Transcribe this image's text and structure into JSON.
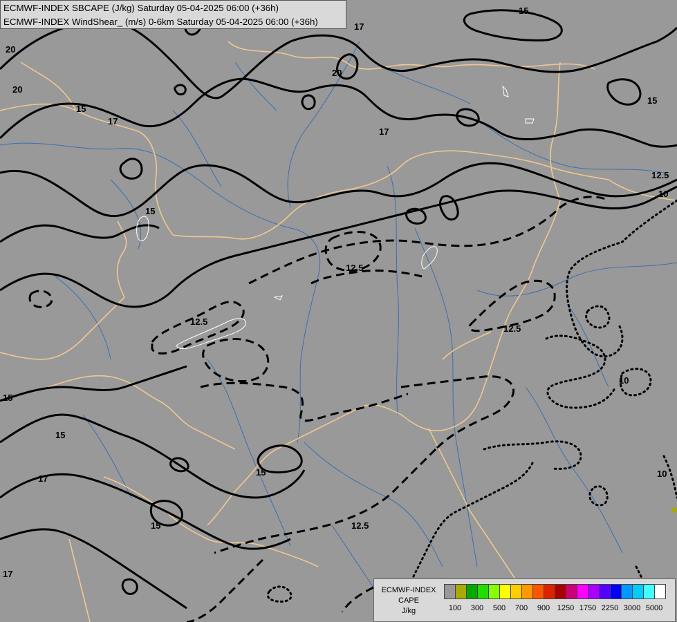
{
  "header": {
    "line1": "ECMWF-INDEX SBCAPE (J/kg) Saturday 05-04-2025 06:00 (+36h)",
    "line2": "ECMWF-INDEX WindShear_ (m/s) 0-6km Saturday 05-04-2025 06:00 (+36h)"
  },
  "legend": {
    "title_line1": "ECMWF-INDEX",
    "title_line2": "CAPE",
    "title_line3": "J/kg",
    "colors": [
      "#999999",
      "#aaaa00",
      "#00aa00",
      "#22dd00",
      "#88ff00",
      "#ffff00",
      "#ffcc00",
      "#ff9900",
      "#ff5500",
      "#dd2200",
      "#aa0000",
      "#cc0077",
      "#ff00ff",
      "#aa00ff",
      "#5500ff",
      "#0000ff",
      "#0099ff",
      "#00ccff",
      "#44ffff",
      "#ffffff"
    ],
    "tick_labels": [
      "100",
      "300",
      "500",
      "700",
      "900",
      "1250",
      "1750",
      "2250",
      "3000",
      "5000"
    ]
  },
  "contour_labels": {
    "c20a": "20",
    "c20b": "20",
    "c20c": "20",
    "c17a": "17",
    "c17b": "17",
    "c17c": "17",
    "c17d": "17",
    "c17e": "17",
    "c15a": "15",
    "c15b": "15",
    "c15c": "15",
    "c15d": "15",
    "c15e": "15",
    "c15f": "15",
    "c15g": "15",
    "c15h": "15",
    "c125a": "12.5",
    "c125b": "12.5",
    "c125c": "12.5",
    "c125d": "12.5",
    "c125e": "12.5",
    "c10a": "10",
    "c10b": "10",
    "c10c": "10"
  },
  "map_colors": {
    "background": "#999999",
    "borders": "#f0c890",
    "rivers": "#3a6fb0",
    "contours": "#000000"
  }
}
